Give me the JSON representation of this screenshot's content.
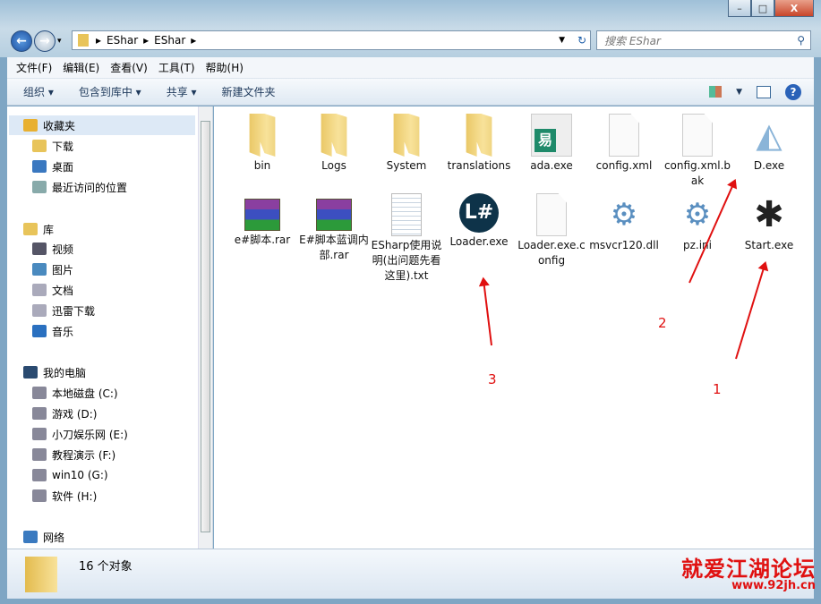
{
  "window": {
    "minimize": "–",
    "maximize": "□",
    "close": "X"
  },
  "address": {
    "crumbs": [
      "EShar",
      "EShar"
    ],
    "search_placeholder": "搜索 EShar"
  },
  "menu": [
    "文件(F)",
    "编辑(E)",
    "查看(V)",
    "工具(T)",
    "帮助(H)"
  ],
  "toolbar": {
    "organize": "组织 ▾",
    "include_library": "包含到库中 ▾",
    "share": "共享 ▾",
    "new_folder": "新建文件夹"
  },
  "sidebar": {
    "items": [
      {
        "label": "收藏夹",
        "icon": "star-icon",
        "color": "#e8b030"
      },
      {
        "label": "下载",
        "icon": "download-folder-icon",
        "color": "#e8c45a"
      },
      {
        "label": "桌面",
        "icon": "desktop-icon",
        "color": "#3a78c0"
      },
      {
        "label": "最近访问的位置",
        "icon": "recent-places-icon",
        "color": "#8aa"
      },
      {
        "label": "库",
        "icon": "library-icon",
        "color": "#e8c45a"
      },
      {
        "label": "视频",
        "icon": "video-icon",
        "color": "#556"
      },
      {
        "label": "图片",
        "icon": "picture-icon",
        "color": "#4a8abf"
      },
      {
        "label": "文档",
        "icon": "document-icon",
        "color": "#aab"
      },
      {
        "label": "迅雷下载",
        "icon": "folder-icon",
        "color": "#aab"
      },
      {
        "label": "音乐",
        "icon": "music-icon",
        "color": "#2a70c0"
      },
      {
        "label": "我的电脑",
        "icon": "computer-icon",
        "color": "#2a4a70"
      },
      {
        "label": "本地磁盘 (C:)",
        "icon": "drive-icon",
        "color": "#889"
      },
      {
        "label": "游戏 (D:)",
        "icon": "drive-icon",
        "color": "#889"
      },
      {
        "label": "小刀娱乐网 (E:)",
        "icon": "drive-icon",
        "color": "#889"
      },
      {
        "label": "教程演示 (F:)",
        "icon": "drive-icon",
        "color": "#889"
      },
      {
        "label": "win10 (G:)",
        "icon": "drive-icon",
        "color": "#889"
      },
      {
        "label": "软件 (H:)",
        "icon": "drive-icon",
        "color": "#889"
      },
      {
        "label": "网络",
        "icon": "network-icon",
        "color": "#3a7ac0"
      }
    ]
  },
  "files": [
    {
      "name": "bin",
      "type": "fold"
    },
    {
      "name": "Logs",
      "type": "fold"
    },
    {
      "name": "System",
      "type": "fold"
    },
    {
      "name": "translations",
      "type": "fold"
    },
    {
      "name": "ada.exe",
      "type": "ada"
    },
    {
      "name": "config.xml",
      "type": "doc"
    },
    {
      "name": "config.xml.bak",
      "type": "doc"
    },
    {
      "name": "D.exe",
      "type": "dexe"
    },
    {
      "name": "e#脚本.rar",
      "type": "rar"
    },
    {
      "name": "E#脚本蓝调内部.rar",
      "type": "rar"
    },
    {
      "name": "ESharp使用说明(出问题先看这里).txt",
      "type": "txt"
    },
    {
      "name": "Loader.exe",
      "type": "loader"
    },
    {
      "name": "Loader.exe.config",
      "type": "doc"
    },
    {
      "name": "msvcr120.dll",
      "type": "gear"
    },
    {
      "name": "pz.ini",
      "type": "gear"
    },
    {
      "name": "Start.exe",
      "type": "start"
    }
  ],
  "status": {
    "count": "16 个对象"
  },
  "annotations": {
    "n1": "1",
    "n2": "2",
    "n3": "3"
  },
  "watermark": {
    "title": "就爱江湖论坛",
    "url": "www.92jh.cn"
  }
}
